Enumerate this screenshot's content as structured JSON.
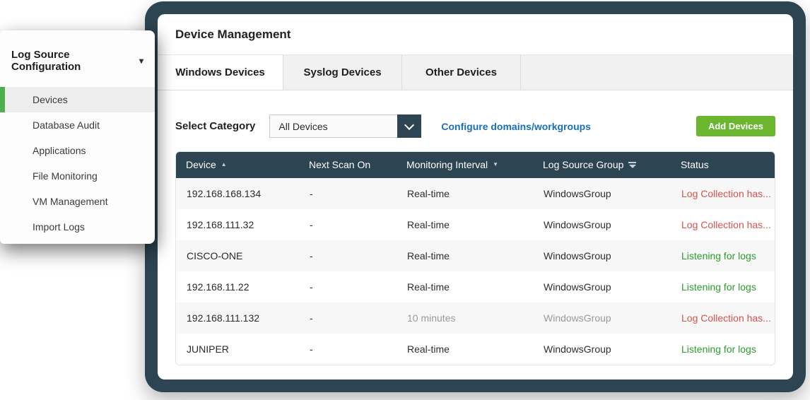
{
  "sidebar": {
    "title": "Log Source Configuration",
    "items": [
      {
        "label": "Devices",
        "active": true
      },
      {
        "label": "Database Audit",
        "active": false
      },
      {
        "label": "Applications",
        "active": false
      },
      {
        "label": "File Monitoring",
        "active": false
      },
      {
        "label": "VM Management",
        "active": false
      },
      {
        "label": "Import Logs",
        "active": false
      }
    ]
  },
  "panel": {
    "title": "Device Management",
    "tabs": [
      {
        "label": "Windows Devices",
        "active": true
      },
      {
        "label": "Syslog Devices",
        "active": false
      },
      {
        "label": "Other Devices",
        "active": false
      }
    ],
    "toolbar": {
      "category_label": "Select Category",
      "category_value": "All Devices",
      "link_label": "Configure domains/workgroups",
      "add_button_label": "Add Devices"
    },
    "table": {
      "columns": [
        {
          "label": "Device",
          "sort": "asc"
        },
        {
          "label": "Next Scan On"
        },
        {
          "label": "Monitoring Interval",
          "sort": "desc"
        },
        {
          "label": "Log Source Group",
          "filter": true
        },
        {
          "label": "Status"
        }
      ],
      "rows": [
        {
          "device": "192.168.168.134",
          "next_scan": "-",
          "interval": "Real-time",
          "group": "WindowsGroup",
          "status": "Log Collection has...",
          "status_type": "error",
          "muted": false
        },
        {
          "device": "192.168.111.32",
          "next_scan": "-",
          "interval": "Real-time",
          "group": "WindowsGroup",
          "status": "Log Collection has...",
          "status_type": "error",
          "muted": false
        },
        {
          "device": "CISCO-ONE",
          "next_scan": "-",
          "interval": "Real-time",
          "group": "WindowsGroup",
          "status": "Listening for logs",
          "status_type": "ok",
          "muted": false
        },
        {
          "device": "192.168.11.22",
          "next_scan": "-",
          "interval": "Real-time",
          "group": "WindowsGroup",
          "status": "Listening for logs",
          "status_type": "ok",
          "muted": false
        },
        {
          "device": "192.168.111.132",
          "next_scan": "-",
          "interval": "10 minutes",
          "group": "WindowsGroup",
          "status": "Log Collection has...",
          "status_type": "error",
          "muted": true
        },
        {
          "device": "JUNIPER",
          "next_scan": "-",
          "interval": "Real-time",
          "group": "WindowsGroup",
          "status": "Listening for logs",
          "status_type": "ok",
          "muted": false
        }
      ]
    }
  },
  "colors": {
    "frame_navy": "#2d4452",
    "table_header_navy": "#2d4452",
    "button_green": "#6ab62f",
    "sidebar_accent_green": "#4eb04c",
    "link_blue": "#1a6fba",
    "status_red": "#d9534f",
    "status_green": "#2b9e2b"
  }
}
